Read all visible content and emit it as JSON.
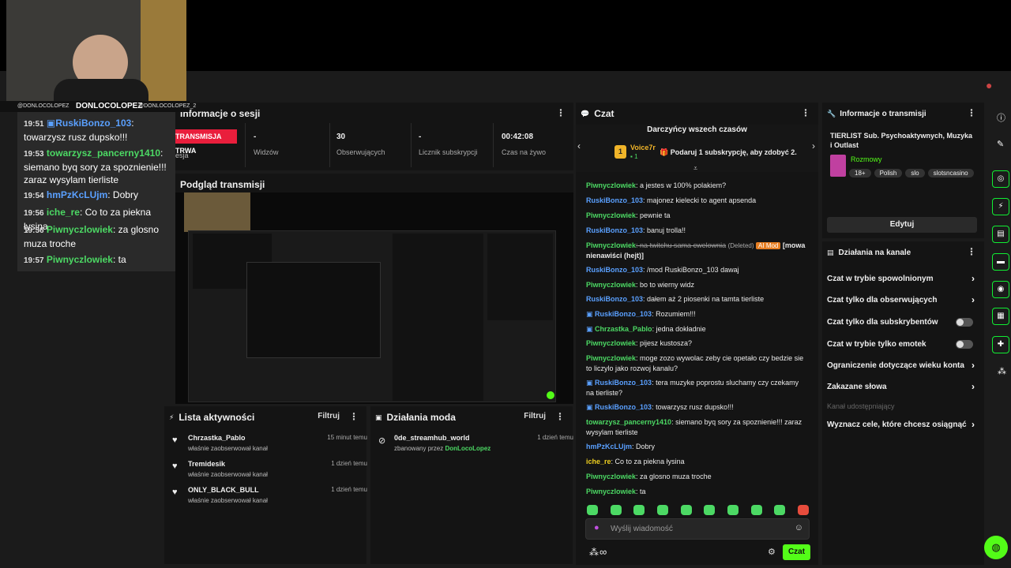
{
  "session": {
    "title": "Informacje o sesji",
    "live_badge": "TRANSMISJA TRWA",
    "live_sub": "esja",
    "stats": [
      {
        "value": "-",
        "label": "Widzów"
      },
      {
        "value": "30",
        "label": "Obserwujących"
      },
      {
        "value": "-",
        "label": "Licznik subskrypcji"
      },
      {
        "value": "00:42:08",
        "label": "Czas na żywo"
      }
    ]
  },
  "preview": {
    "title": "Podgląd transmisji"
  },
  "activity": {
    "title": "Lista aktywności",
    "filter": "Filtruj",
    "items": [
      {
        "name": "Chrzastka_Pablo",
        "sub": "właśnie zaobserwował kanał",
        "time": "15 minut temu"
      },
      {
        "name": "Tremidesik",
        "sub": "właśnie zaobserwował kanał",
        "time": "1 dzień temu"
      },
      {
        "name": "ONLY_BLACK_BULL",
        "sub": "właśnie zaobserwował kanał",
        "time": "1 dzień temu"
      }
    ]
  },
  "mod": {
    "title": "Działania moda",
    "filter": "Filtruj",
    "item_name": "0de_streamhub_world",
    "item_sub": "zbanowany przez",
    "item_by": "DonLocoLopez",
    "item_time": "1 dzień temu"
  },
  "chat": {
    "title": "Czat",
    "leaderboard_title": "Darczyńcy wszech czasów",
    "top_donor": "Voice7r",
    "top_donor_count": "1",
    "rank": "1",
    "gift_text": "Podaruj 1 subskrypcję, aby zdobyć 2.",
    "messages": [
      {
        "user": "Piwnyczlowiek",
        "color": "green",
        "text": ": a jestes w 100% polakiem?"
      },
      {
        "user": "RuskiBonzo_103",
        "color": "blue",
        "text": ": majonez kielecki to agent apsenda"
      },
      {
        "user": "Piwnyczlowiek",
        "color": "green",
        "text": ": pewnie ta"
      },
      {
        "user": "RuskiBonzo_103",
        "color": "blue",
        "text": ": banuj trolla!!"
      },
      {
        "user": "Piwnyczlowiek",
        "color": "green",
        "text": ": na twitchu sama cwelownia"
      },
      {
        "user": "RuskiBonzo_103",
        "color": "blue",
        "text": ": /mod RuskiBonzo_103 dawaj"
      },
      {
        "user": "Piwnyczlowiek",
        "color": "green",
        "text": ": bo to wierny widz"
      },
      {
        "user": "RuskiBonzo_103",
        "color": "blue",
        "text": ": dałem aż 2 piosenki na tamta tierliste"
      },
      {
        "user": "RuskiBonzo_103",
        "color": "blue",
        "text": ": Rozumiem!!!"
      },
      {
        "user": "Chrzastka_Pablo",
        "color": "green",
        "text": ": jedna dokładnie"
      },
      {
        "user": "Piwnyczlowiek",
        "color": "green",
        "text": ": pijesz kustosza?"
      },
      {
        "user": "Piwnyczlowiek",
        "color": "green",
        "text": ": moge zozo wywolac zeby cie opetało czy bedzie sie to liczylo jako rozwoj kanalu?"
      },
      {
        "user": "RuskiBonzo_103",
        "color": "blue",
        "text": ": tera muzyke poprostu sluchamy czy czekamy na tierliste?"
      },
      {
        "user": "RuskiBonzo_103",
        "color": "blue",
        "text": ": towarzysz rusz dupsko!!!"
      },
      {
        "user": "towarzysz_pancerny1410",
        "color": "green",
        "text": ": siemano byq sory za spoznienie!!! zaraz wysylam tierliste"
      },
      {
        "user": "hmPzKcLUjm",
        "color": "blue",
        "text": ": Dobry"
      },
      {
        "user": "iche_re",
        "color": "green",
        "text": ": Co to za piekna łysina"
      },
      {
        "user": "Piwnyczlowiek",
        "color": "green",
        "text": ": za glosno muza troche"
      },
      {
        "user": "Piwnyczlowiek",
        "color": "green",
        "text": ": ta"
      }
    ],
    "deleted_label": "(Deleted)",
    "ai_mod_label": "AI Mod",
    "ai_mod_reason": "[mowa nienawiści (hejt)]",
    "input_placeholder": "Wyślij wiadomość",
    "send_label": "Czat",
    "infinity": "∞"
  },
  "stream_info": {
    "title": "Informacje o transmisji",
    "stream_title": "TIERLIST Sub. Psychoaktywnych, Muzyka i Outlast",
    "category": "Rozmowy",
    "tags": [
      "18+",
      "Polish",
      "slo",
      "slotsncasino"
    ],
    "edit": "Edytuj"
  },
  "channel_actions": {
    "title": "Działania na kanale",
    "items": [
      {
        "label": "Czat w trybie spowolnionym",
        "kind": "chevron"
      },
      {
        "label": "Czat tylko dla obserwujących",
        "kind": "chevron"
      },
      {
        "label": "Czat tylko dla subskrybentów",
        "kind": "toggle"
      },
      {
        "label": "Czat w trybie tylko emotek",
        "kind": "toggle"
      },
      {
        "label": "Ograniczenie dotyczące wieku konta",
        "kind": "chevron"
      },
      {
        "label": "Zakazane słowa",
        "kind": "chevron"
      },
      {
        "label": "Kanał udostępniający",
        "kind": "disabled"
      },
      {
        "label": "Wyznacz cele, które chcesz osiągnąć",
        "kind": "chevron"
      }
    ]
  },
  "overlay": {
    "left_handle": "@DONLOCOLOPEZ",
    "name": "DONLOCOLOPEZ",
    "right_handle": "@DONLOCOLOPEZ_2",
    "messages": [
      {
        "time": "19:51",
        "user": "RuskiBonzo_103",
        "color": "blue",
        "text": ": towarzysz rusz dupsko!!!"
      },
      {
        "time": "19:53",
        "user": "towarzysz_pancerny1410",
        "color": "green",
        "text": ": siemano byq sory za spoznienie!!! zaraz wysylam tierliste"
      },
      {
        "time": "19:54",
        "user": "hmPzKcLUjm",
        "color": "blue",
        "text": ": Dobry"
      },
      {
        "time": "19:56",
        "user": "iche_re",
        "color": "green",
        "text": ": Co to za piekna łysina"
      },
      {
        "time": "19:56",
        "user": "Piwnyczlowiek",
        "color": "green",
        "text": ": za glosno muza troche"
      },
      {
        "time": "19:57",
        "user": "Piwnyczlowiek",
        "color": "green",
        "text": ": ta"
      }
    ]
  },
  "colors": {
    "accent": "#53fc18",
    "live": "#e91e3c",
    "username_green": "#4cd964",
    "username_blue": "#5aa0ff"
  }
}
